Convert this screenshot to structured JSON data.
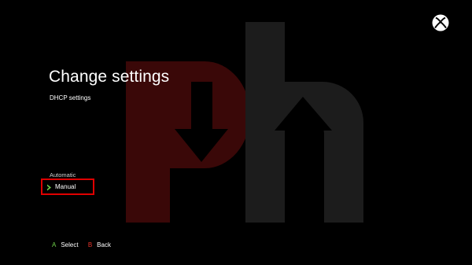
{
  "page": {
    "title": "Change settings",
    "subtitle": "DHCP settings"
  },
  "options": [
    {
      "label": "Automatic"
    },
    {
      "label": "Manual"
    }
  ],
  "footer": {
    "select_key": "A",
    "select_label": "Select",
    "back_key": "B",
    "back_label": "Back"
  },
  "icons": {
    "top_right": "xbox-logo-icon",
    "selected_marker": "chevron-right-icon",
    "background": "ph-watermark-logo"
  },
  "colors": {
    "background": "#000000",
    "accent_green": "#6fd14a",
    "accent_red": "#e8342a",
    "selection_border": "#e00000",
    "watermark_red": "#3a0808",
    "watermark_gray": "#1c1c1c"
  }
}
